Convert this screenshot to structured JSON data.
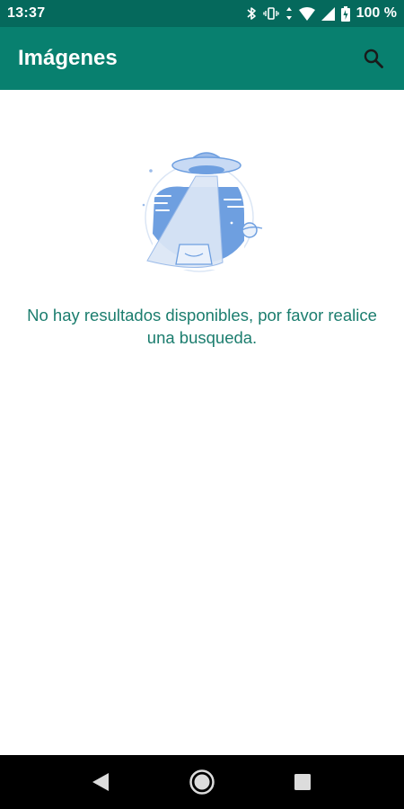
{
  "status_bar": {
    "time": "13:37",
    "battery_label": "100 %",
    "icons": [
      "bluetooth-icon",
      "vibrate-icon",
      "data-arrows-icon",
      "wifi-icon",
      "signal-icon",
      "battery-icon"
    ]
  },
  "app_bar": {
    "title": "Imágenes",
    "search_icon": "search-icon"
  },
  "empty_state": {
    "illustration": "ufo-illustration",
    "message": "No hay resultados disponibles, por favor realice una busqueda."
  },
  "nav_bar": {
    "icons": [
      "back-icon",
      "home-icon",
      "recents-icon"
    ]
  },
  "colors": {
    "status_bar": "#05695c",
    "app_bar": "#08806f",
    "message_text": "#1b7d6e",
    "illustration_blue": "#6e9fe0"
  }
}
